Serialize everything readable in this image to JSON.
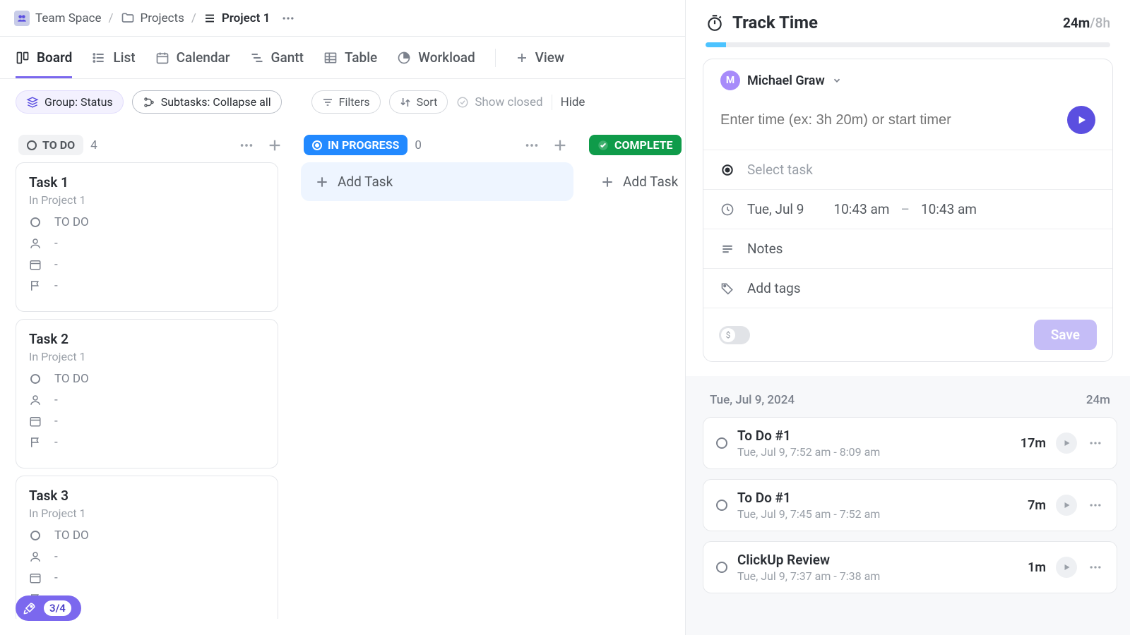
{
  "breadcrumb": {
    "space": "Team Space",
    "folder": "Projects",
    "project": "Project 1"
  },
  "views": {
    "board": "Board",
    "list": "List",
    "calendar": "Calendar",
    "gantt": "Gantt",
    "table": "Table",
    "workload": "Workload",
    "add": "View"
  },
  "toolbar": {
    "group": "Group: Status",
    "subtasks": "Subtasks: Collapse all",
    "filters": "Filters",
    "sort": "Sort",
    "show_closed": "Show closed",
    "hide": "Hide"
  },
  "columns": {
    "todo": {
      "label": "TO DO",
      "count": "4"
    },
    "progress": {
      "label": "IN PROGRESS",
      "count": "0"
    },
    "complete": {
      "label": "COMPLETE"
    },
    "add_task": "Add Task"
  },
  "tasks": [
    {
      "title": "Task 1",
      "sub": "In Project 1",
      "status": "TO DO"
    },
    {
      "title": "Task 2",
      "sub": "In Project 1",
      "status": "TO DO"
    },
    {
      "title": "Task 3",
      "sub": "In Project 1",
      "status": "TO DO"
    }
  ],
  "launcher": {
    "count": "3/4"
  },
  "time_panel": {
    "title": "Track Time",
    "used": "24m",
    "cap": "8h",
    "progress_pct": 5,
    "user": {
      "initial": "M",
      "name": "Michael Graw"
    },
    "input_placeholder": "Enter time (ex: 3h 20m) or start timer",
    "select_task": "Select task",
    "date": "Tue, Jul 9",
    "start": "10:43 am",
    "sep": "–",
    "end": "10:43 am",
    "notes": "Notes",
    "tags": "Add tags",
    "save": "Save"
  },
  "log": {
    "date": "Tue, Jul 9, 2024",
    "total": "24m",
    "items": [
      {
        "title": "To Do #1",
        "range": "Tue, Jul 9, 7:52 am - 8:09 am",
        "dur": "17m"
      },
      {
        "title": "To Do #1",
        "range": "Tue, Jul 9, 7:45 am - 7:52 am",
        "dur": "7m"
      },
      {
        "title": "ClickUp Review",
        "range": "Tue, Jul 9, 7:37 am - 7:38 am",
        "dur": "1m"
      }
    ]
  }
}
